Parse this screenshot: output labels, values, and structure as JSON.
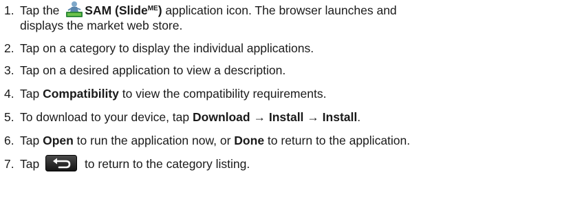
{
  "steps": [
    {
      "num": "1.",
      "before": "Tap the ",
      "icon": "sam-app-icon",
      "bold": "SAM (Slide",
      "superscript": "ME",
      "bold_close": ")",
      "after": " application icon. The browser launches and",
      "line2": "displays the market web store."
    },
    {
      "num": "2.",
      "text": "Tap on a category to display the individual applications."
    },
    {
      "num": "3.",
      "text": "Tap on a desired application to view a description."
    },
    {
      "num": "4.",
      "before": "Tap ",
      "bold": "Compatibility",
      "after": " to view the compatibility requirements."
    },
    {
      "num": "5.",
      "before": "To download to your device, tap ",
      "bold1": "Download",
      "arrow1": " → ",
      "bold2": "Install",
      "arrow2": " → ",
      "bold3": "Install",
      "after": "."
    },
    {
      "num": "6.",
      "before": "Tap ",
      "bold1": "Open",
      "mid": " to run the application now, or ",
      "bold2": "Done",
      "after": " to return to the application."
    },
    {
      "num": "7.",
      "before": "Tap ",
      "icon": "back-arrow-icon",
      "after": " to return to the category listing."
    }
  ]
}
